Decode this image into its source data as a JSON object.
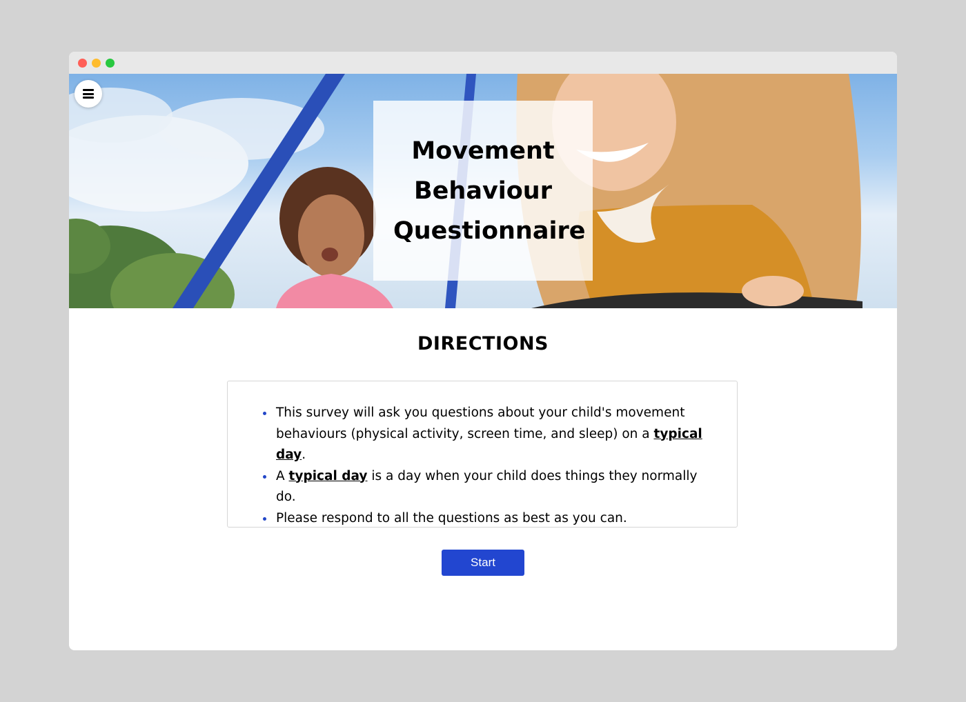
{
  "hero": {
    "title": "Movement Behaviour Questionnaire"
  },
  "menu": {
    "icon": "hamburger-menu-icon"
  },
  "directions": {
    "heading": "DIRECTIONS",
    "items": [
      {
        "parts": [
          {
            "text": "This survey will ask you questions about your child's movement behaviours (physical activity, screen time, and sleep) on a ",
            "emphasis": false
          },
          {
            "text": "typical day",
            "emphasis": true
          },
          {
            "text": ".",
            "emphasis": false
          }
        ]
      },
      {
        "parts": [
          {
            "text": "A ",
            "emphasis": false
          },
          {
            "text": "typical day",
            "emphasis": true
          },
          {
            "text": " is a day when your child does things they normally do.",
            "emphasis": false
          }
        ]
      },
      {
        "parts": [
          {
            "text": "Please respond to all the questions as best as you can.",
            "emphasis": false
          }
        ]
      }
    ]
  },
  "start_button": {
    "label": "Start"
  },
  "colors": {
    "accent": "#2246d0",
    "bullet": "#2246c8",
    "page_background": "#d3d3d3"
  }
}
